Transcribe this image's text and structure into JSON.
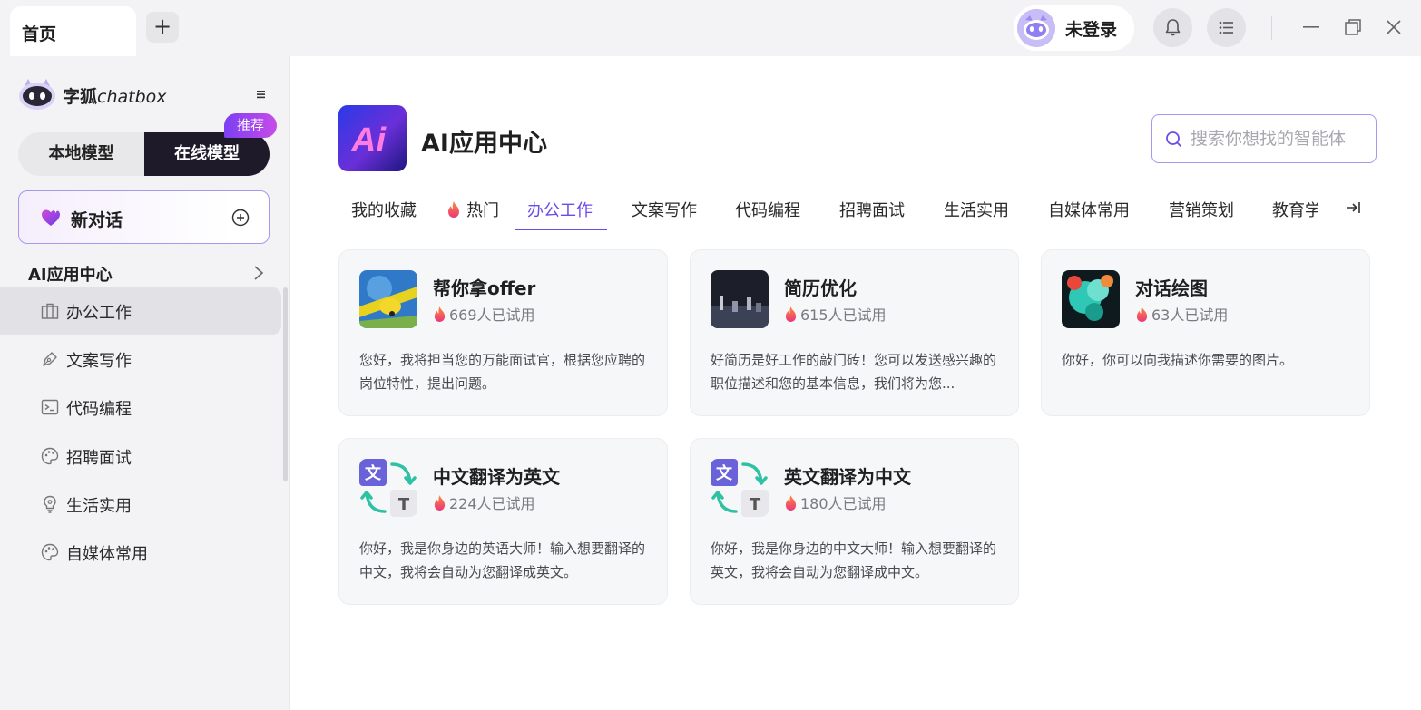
{
  "titlebar": {
    "home_tab": "首页",
    "add_tab": "+",
    "user_name": "未登录"
  },
  "sidebar": {
    "brand_prefix": "字狐",
    "brand_suffix": "chatbox",
    "model_local": "本地模型",
    "model_online": "在线模型",
    "recommend_badge": "推荐",
    "new_chat": "新对话",
    "section_title": "AI应用中心",
    "items": [
      {
        "label": "办公工作",
        "icon": "briefcase-icon",
        "active": true
      },
      {
        "label": "文案写作",
        "icon": "pen-icon"
      },
      {
        "label": "代码编程",
        "icon": "terminal-icon"
      },
      {
        "label": "招聘面试",
        "icon": "palette-icon"
      },
      {
        "label": "生活实用",
        "icon": "lightbulb-icon"
      },
      {
        "label": "自媒体常用",
        "icon": "palette-icon"
      }
    ]
  },
  "main": {
    "logo_text": "Ai",
    "title": "AI应用中心",
    "search_placeholder": "搜索你想找的智能体",
    "tabs": [
      "我的收藏",
      "热门",
      "办公工作",
      "文案写作",
      "代码编程",
      "招聘面试",
      "生活实用",
      "自媒体常用",
      "营销策划",
      "教育学"
    ],
    "active_tab": "办公工作",
    "cards": [
      {
        "name": "帮你拿offer",
        "users": "669人已试用",
        "desc": "您好，我将担当您的万能面试官，根据您应聘的岗位特性，提出问题。"
      },
      {
        "name": "简历优化",
        "users": "615人已试用",
        "desc": "好简历是好工作的敲门砖！您可以发送感兴趣的职位描述和您的基本信息，我们将为您..."
      },
      {
        "name": "对话绘图",
        "users": "63人已试用",
        "desc": "你好，你可以向我描述你需要的图片。"
      },
      {
        "name": "中文翻译为英文",
        "users": "224人已试用",
        "desc": "你好，我是你身边的英语大师！输入想要翻译的中文，我将会自动为您翻译成英文。"
      },
      {
        "name": "英文翻译为中文",
        "users": "180人已试用",
        "desc": "你好，我是你身边的中文大师！输入想要翻译的英文，我将会自动为您翻译成中文。"
      }
    ]
  },
  "colors": {
    "accent": "#6c4ce8",
    "online_bg": "#1f1a29",
    "fire": "#f0503c"
  }
}
